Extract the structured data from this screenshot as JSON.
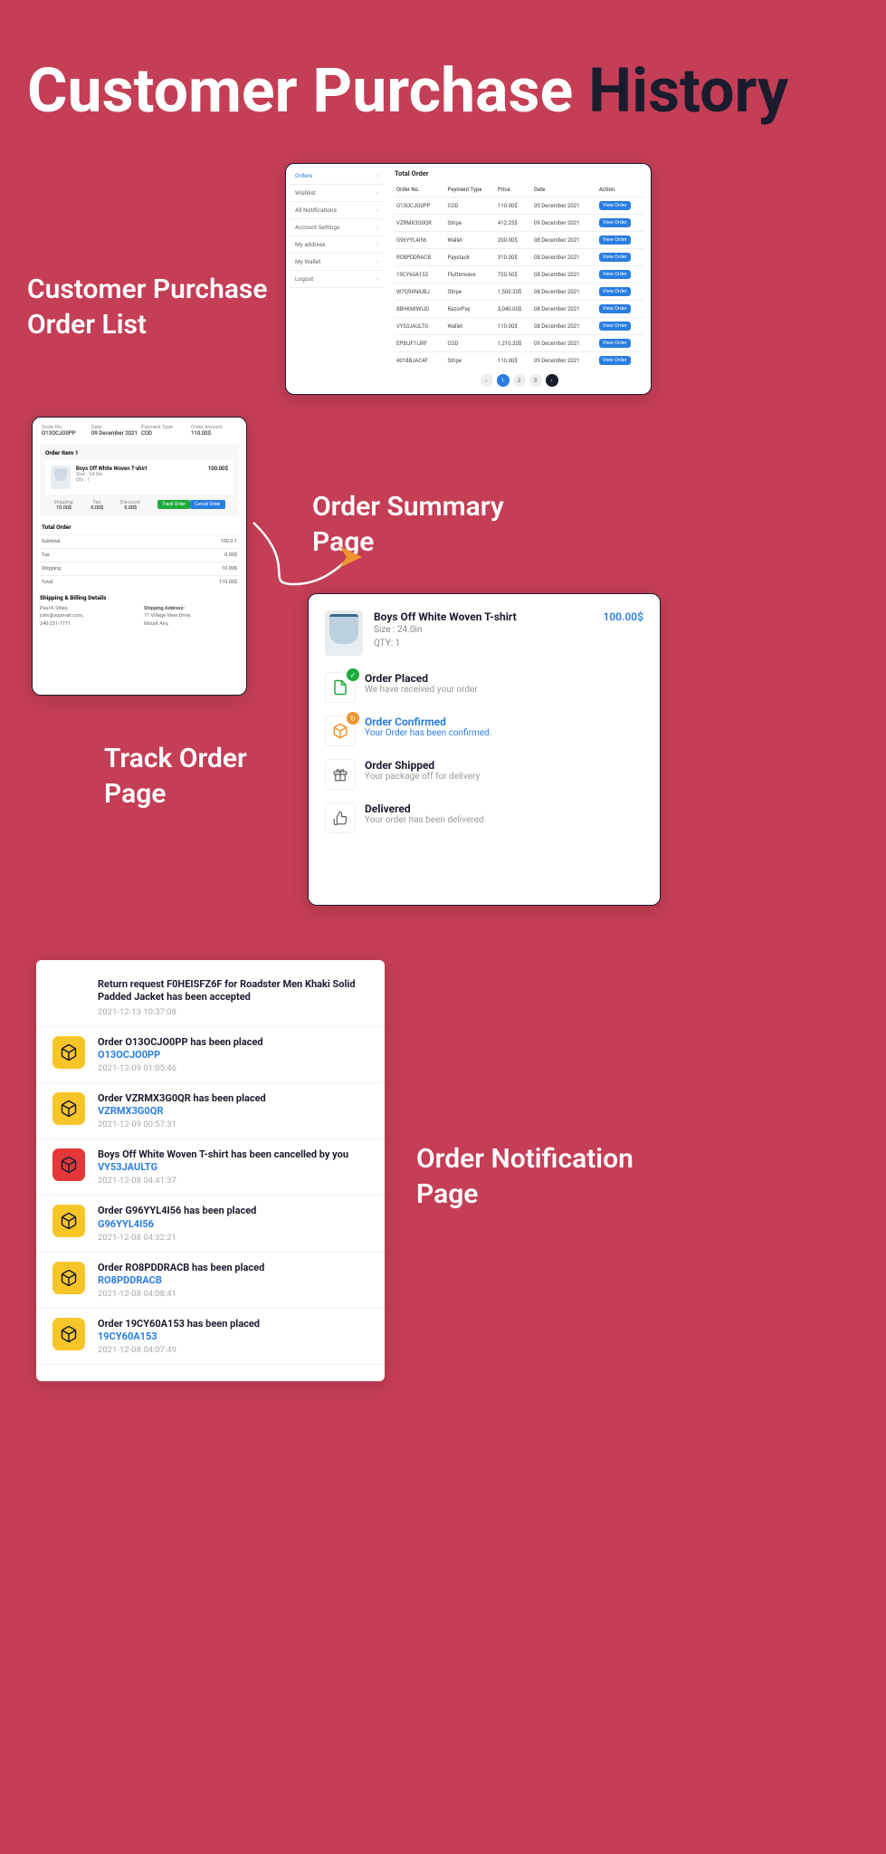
{
  "hero": {
    "white": "Customer Purchase ",
    "dark": "History"
  },
  "labels": {
    "orderlist": "Customer Purchase\nOrder List",
    "summary": "Order Summary\nPage",
    "track": "Track Order\nPage",
    "notify": "Order Notification\nPage"
  },
  "sidebar": {
    "items": [
      {
        "label": "Orders",
        "active": true
      },
      {
        "label": "Wishlist",
        "active": false
      },
      {
        "label": "All Notifications",
        "active": false
      },
      {
        "label": "Account Settings",
        "active": false
      },
      {
        "label": "My address",
        "active": false
      },
      {
        "label": "My Wallet",
        "active": false
      },
      {
        "label": "Logout",
        "active": false
      }
    ]
  },
  "orderlist": {
    "title": "Total Order",
    "headers": [
      "Order No.",
      "Payment Type",
      "Price",
      "Date",
      "Action"
    ],
    "rows": [
      [
        "O13OCJO0PP",
        "COD",
        "110.00$",
        "09 December 2021"
      ],
      [
        "VZRMX3G0QR",
        "Stripe",
        "412.25$",
        "09 December 2021"
      ],
      [
        "G96YYL4I56",
        "Wallet",
        "200.00$",
        "08 December 2021"
      ],
      [
        "RO8PDDRACB",
        "Paystack",
        "310.00$",
        "08 December 2021"
      ],
      [
        "19CY60A153",
        "Flutterwave",
        "720.50$",
        "08 December 2021"
      ],
      [
        "W7Q9XNIUBJ",
        "Stripe",
        "1,500.20$",
        "08 December 2021"
      ],
      [
        "8BHKMIWIJD",
        "RazorPay",
        "3,040.00$",
        "08 December 2021"
      ],
      [
        "VY53JAULTG",
        "Wallet",
        "110.00$",
        "08 December 2021"
      ],
      [
        "EP8IJF1IJRF",
        "COD",
        "1,210.20$",
        "09 December 2021"
      ],
      [
        "4018BJAC4F",
        "Stripe",
        "110.00$",
        "09 December 2021"
      ]
    ],
    "view_label": "View Order",
    "pages": [
      "1",
      "2",
      "3"
    ]
  },
  "summary": {
    "head": [
      {
        "lbl": "Order No:",
        "val": "O13OCJO0PP"
      },
      {
        "lbl": "Date:",
        "val": "09 December 2021"
      },
      {
        "lbl": "Payment Type:",
        "val": "COD"
      },
      {
        "lbl": "Order Amount:",
        "val": "110.00$"
      }
    ],
    "item_title": "Order Item 1",
    "product": {
      "name": "Boys Off White Woven T-shirt",
      "size": "Size : 24.0in",
      "qty": "Qty : 1",
      "price": "100.00$"
    },
    "fees": [
      {
        "lbl": "Shipping:",
        "val": "10.00$"
      },
      {
        "lbl": "Tax:",
        "val": "0.00$"
      },
      {
        "lbl": "Discount:",
        "val": "0.00$"
      }
    ],
    "track_btn": "Track Order",
    "cancel_btn": "Cancel Order",
    "total_title": "Total Order",
    "totals": [
      {
        "lbl": "Subtotal",
        "val": "100.0 1"
      },
      {
        "lbl": "Tax",
        "val": "0.00$"
      },
      {
        "lbl": "Shipping",
        "val": "10.00$"
      },
      {
        "lbl": "Total",
        "val": "110.00$"
      }
    ],
    "billing_title": "Shipping & Billing Details",
    "billing_left": [
      "Paul K Stiles,",
      "john@yopmail.com,",
      "240-231-7771"
    ],
    "billing_right_lbl": "Shipping Address:",
    "billing_right": [
      "71 Village View Drive,",
      "Mount Airy,"
    ]
  },
  "track": {
    "product": {
      "name": "Boys Off White Woven T-shirt",
      "size": "Size : 24.0in",
      "qty": "QTY: 1",
      "price": "100.00$"
    },
    "steps": [
      {
        "title": "Order Placed",
        "sub": "We have received your order",
        "icon": "doc",
        "badge": "green",
        "active": false
      },
      {
        "title": "Order Confirmed",
        "sub": "Your Order has been confirmed.",
        "icon": "box",
        "badge": "orange",
        "active": true
      },
      {
        "title": "Order Shipped",
        "sub": "Your package off for delivery",
        "icon": "gift",
        "badge": "",
        "active": false
      },
      {
        "title": "Delivered",
        "sub": "Your order has been delivered",
        "icon": "thumb",
        "badge": "",
        "active": false
      }
    ]
  },
  "notifications": [
    {
      "icon": "",
      "title": "Return request F0HEISFZ6F for Roadster Men Khaki Solid Padded Jacket has been accepted",
      "link": "",
      "time": "2021-12-13 10:37:08"
    },
    {
      "icon": "yellow",
      "title": "Order O13OCJO0PP has been placed",
      "link": "O13OCJO0PP",
      "time": "2021-12-09 01:05:46"
    },
    {
      "icon": "yellow",
      "title": "Order VZRMX3G0QR has been placed",
      "link": "VZRMX3G0QR",
      "time": "2021-12-09 00:57:31"
    },
    {
      "icon": "red",
      "title": "Boys Off White Woven T-shirt has been cancelled by you",
      "link": "VY53JAULTG",
      "time": "2021-12-08 04:41:37"
    },
    {
      "icon": "yellow",
      "title": "Order G96YYL4I56 has been placed",
      "link": "G96YYL4I56",
      "time": "2021-12-08 04:32:21"
    },
    {
      "icon": "yellow",
      "title": "Order RO8PDDRACB has been placed",
      "link": "RO8PDDRACB",
      "time": "2021-12-08 04:08:41"
    },
    {
      "icon": "yellow",
      "title": "Order 19CY60A153 has been placed",
      "link": "19CY60A153",
      "time": "2021-12-08 04:07:49"
    }
  ]
}
